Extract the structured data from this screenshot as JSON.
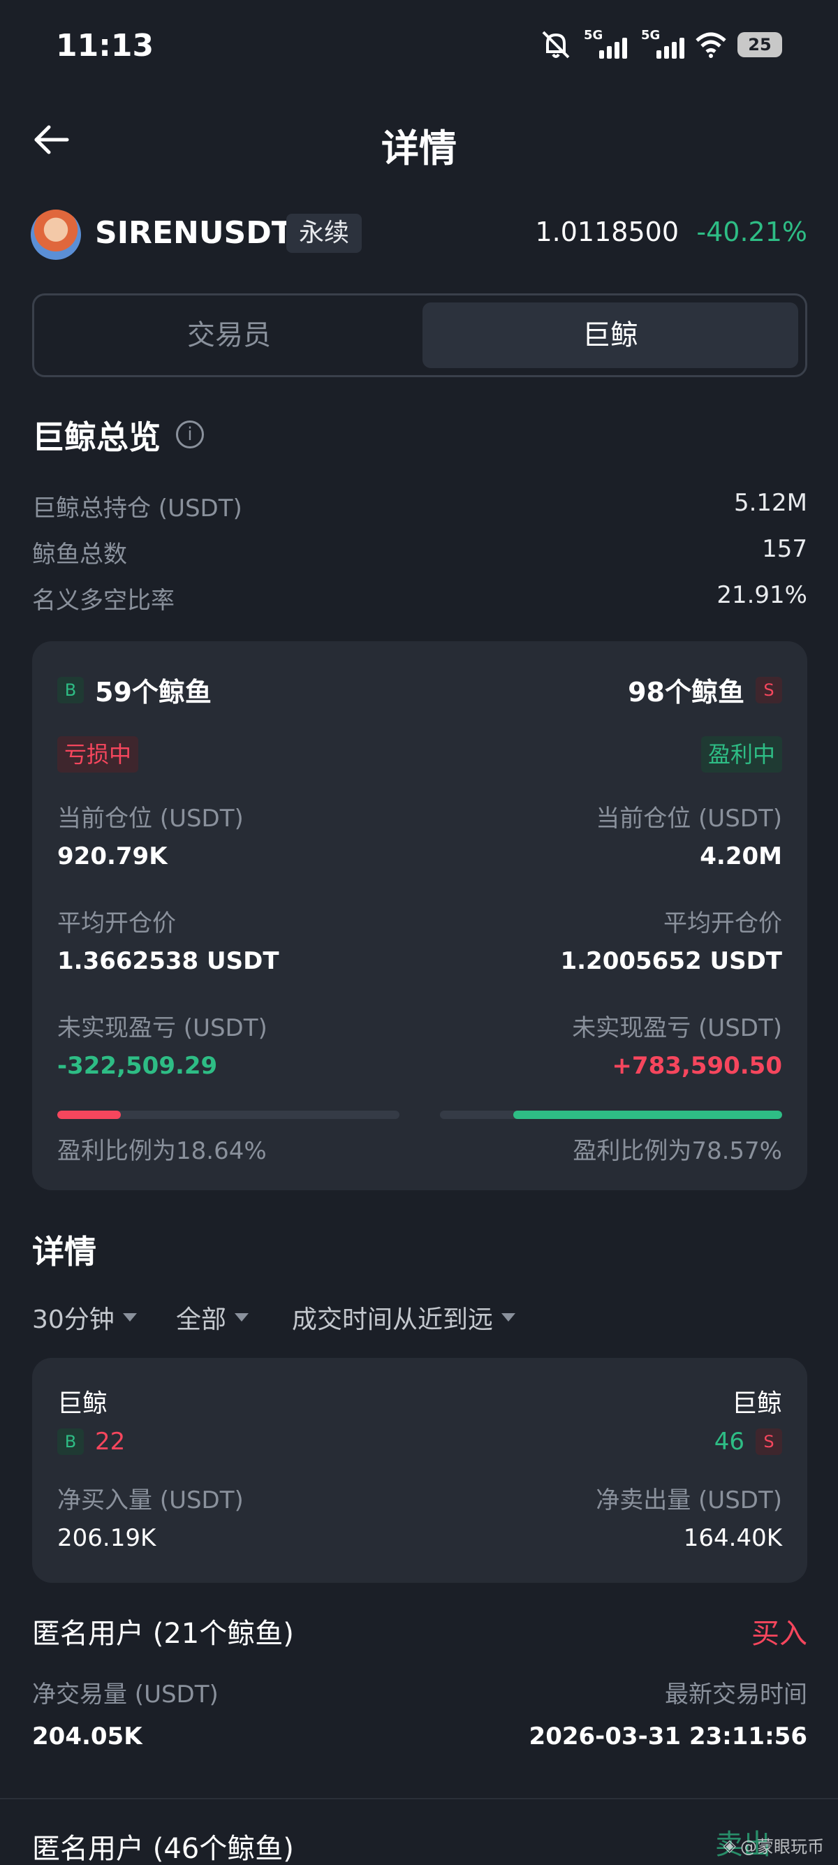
{
  "status": {
    "time": "11:13",
    "net1": "5G",
    "net2": "5G",
    "battery": "25"
  },
  "header": {
    "title": "详情"
  },
  "symbol": {
    "name": "SIRENUSDT",
    "type": "永续",
    "price": "1.0118500",
    "change": "-40.21%"
  },
  "tabs": [
    {
      "label": "交易员"
    },
    {
      "label": "巨鲸"
    }
  ],
  "overview": {
    "title": "巨鲸总览",
    "info_icon": "i",
    "rows": [
      {
        "label": "巨鲸总持仓 (USDT)",
        "value": "5.12M"
      },
      {
        "label": "鲸鱼总数",
        "value": "157"
      },
      {
        "label": "名义多空比率",
        "value": "21.91%"
      }
    ]
  },
  "whale_card": {
    "long": {
      "badge": "B",
      "count": "59个鲸鱼",
      "status": "亏损中",
      "position_label": "当前仓位 (USDT)",
      "position": "920.79K",
      "avg_label": "平均开仓价",
      "avg_price": "1.3662538 USDT",
      "pnl_label": "未实现盈亏 (USDT)",
      "pnl": "-322,509.29",
      "ratio_text": "盈利比例为18.64%",
      "ratio": 0.1864
    },
    "short": {
      "badge": "S",
      "count": "98个鲸鱼",
      "status": "盈利中",
      "position_label": "当前仓位 (USDT)",
      "position": "4.20M",
      "avg_label": "平均开仓价",
      "avg_price": "1.2005652 USDT",
      "pnl_label": "未实现盈亏 (USDT)",
      "pnl": "+783,590.50",
      "ratio_text": "盈利比例为78.57%",
      "ratio": 0.7857
    }
  },
  "details": {
    "title": "详情",
    "filters": [
      "30分钟",
      "全部",
      "成交时间从近到远"
    ],
    "summary": {
      "left_title": "巨鲸",
      "left_badge": "B",
      "left_count": "22",
      "right_title": "巨鲸",
      "right_badge": "S",
      "right_count": "46",
      "buy_label": "净买入量 (USDT)",
      "buy_value": "206.19K",
      "sell_label": "净卖出量 (USDT)",
      "sell_value": "164.40K"
    },
    "records": [
      {
        "name": "匿名用户 (21个鲸鱼)",
        "side": "买入",
        "vol_label": "净交易量 (USDT)",
        "vol": "204.05K",
        "time_label": "最新交易时间",
        "time": "2026-03-31 23:11:56"
      },
      {
        "name": "匿名用户 (46个鲸鱼)",
        "side": "卖出"
      }
    ]
  },
  "watermark": "@蒙眼玩币"
}
